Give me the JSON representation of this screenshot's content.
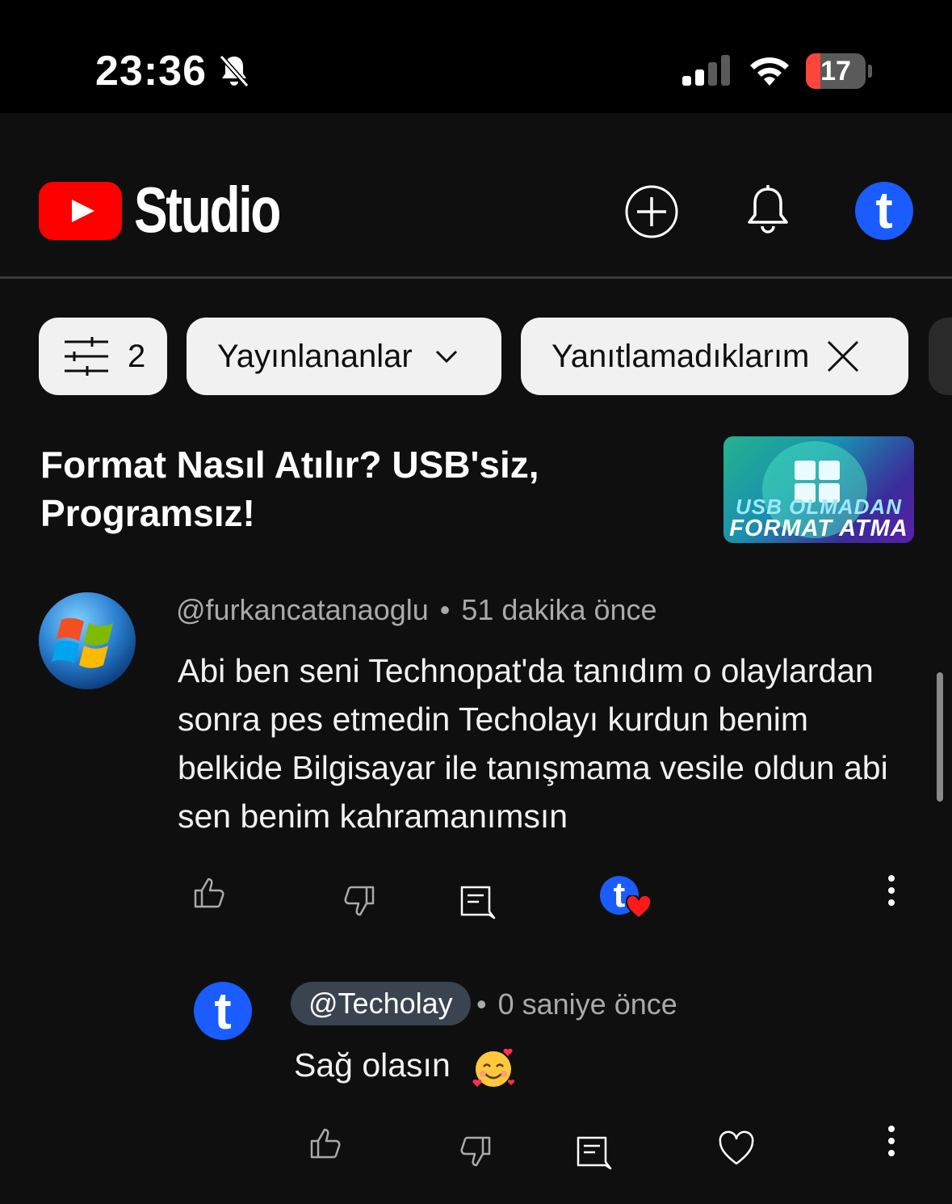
{
  "status_bar": {
    "time": "23:36",
    "battery": "17"
  },
  "header": {
    "brand": "Studio"
  },
  "filters": {
    "count": "2",
    "published_label": "Yayınlananlar",
    "unanswered_label": "Yanıtlamadıklarım"
  },
  "video": {
    "title": "Format Nasıl Atılır? USB'siz, Programsız!",
    "thumb_line1": "USB OLMADAN",
    "thumb_line2": "FORMAT ATMA"
  },
  "comment": {
    "author": "@furkancatanaoglu",
    "separator": "•",
    "time": "51 dakika önce",
    "text": "Abi ben seni Technopat'da tanıdım o olaylardan sonra pes etmedin Techolayı kurdun benim belkide Bilgisayar ile tanışmama vesile oldun abi sen benim kahramanımsın"
  },
  "reply": {
    "channel": "@Techolay",
    "separator": "•",
    "time": "0 saniye önce",
    "text": "Sağ olasın"
  },
  "avatar_letter": "t",
  "colors": {
    "accent_blue": "#1a5cff",
    "youtube_red": "#ff0000",
    "heart_red": "#ff1a1a"
  }
}
